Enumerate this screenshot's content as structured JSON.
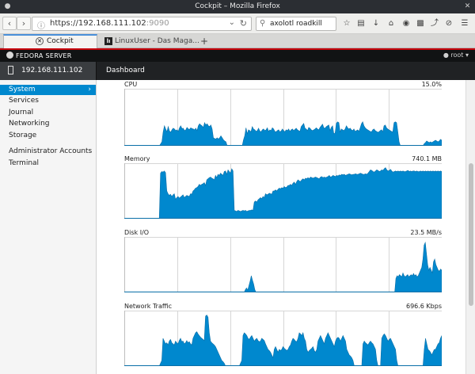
{
  "window": {
    "title": "Cockpit – Mozilla Firefox"
  },
  "nav": {
    "url_host": "https://192.168.111.102",
    "url_port": ":9090",
    "search_value": "axolotl roadkill"
  },
  "tabs": [
    {
      "label": "Cockpit"
    },
    {
      "label": "LinuxUser - Das Maga..."
    }
  ],
  "header": {
    "brand": "FEDORA SERVER",
    "user": "root"
  },
  "host": {
    "name": "192.168.111.102"
  },
  "breadcrumb": "Dashboard",
  "sidebar": {
    "items": [
      {
        "label": "System"
      },
      {
        "label": "Services"
      },
      {
        "label": "Journal"
      },
      {
        "label": "Networking"
      },
      {
        "label": "Storage"
      },
      {
        "label": "Administrator Accounts"
      },
      {
        "label": "Terminal"
      }
    ],
    "active_index": 0
  },
  "colors": {
    "accent": "#0088ce",
    "header_bg": "#111314",
    "brand_red": "#c7000b"
  },
  "charts": [
    {
      "title": "CPU",
      "value": "15.0%",
      "samples": [
        0,
        0,
        0,
        0,
        0,
        0,
        0,
        0,
        0,
        0,
        0,
        0,
        0,
        0,
        0,
        0,
        0,
        0,
        0,
        0,
        0,
        0,
        0,
        0,
        0,
        0,
        0,
        0,
        0,
        0.05,
        0.1,
        0.35,
        0.5,
        0.42,
        0.35,
        0.48,
        0.37,
        0.34,
        0.4,
        0.44,
        0.42,
        0.38,
        0.4,
        0.36,
        0.45,
        0.5,
        0.43,
        0.44,
        0.38,
        0.4,
        0.46,
        0.42,
        0.41,
        0.45,
        0.43,
        0.42,
        0.4,
        0.44,
        0.38,
        0.5,
        0.55,
        0.52,
        0.5,
        0.46,
        0.58,
        0.52,
        0.55,
        0.5,
        0.48,
        0.52,
        0.42,
        0.2,
        0.18,
        0.17,
        0.2,
        0.17,
        0.2,
        0.25,
        0.2,
        0.15,
        0.12,
        0.1,
        0,
        0,
        0,
        0,
        0,
        0,
        0,
        0,
        0,
        0,
        0,
        0,
        0,
        0.15,
        0.25,
        0.45,
        0.3,
        0.4,
        0.38,
        0.35,
        0.48,
        0.42,
        0.4,
        0.36,
        0.38,
        0.44,
        0.37,
        0.35,
        0.4,
        0.42,
        0.38,
        0.4,
        0.45,
        0.36,
        0.4,
        0.38,
        0.45,
        0.42,
        0.36,
        0.35,
        0.38,
        0.4,
        0.35,
        0.37,
        0.42,
        0.38,
        0.35,
        0.4,
        0.38,
        0.42,
        0.36,
        0.4,
        0.42,
        0.38,
        0.41,
        0.44,
        0.4,
        0.38,
        0.36,
        0.48,
        0.52,
        0.56,
        0.44,
        0.42,
        0.38,
        0.46,
        0.44,
        0.4,
        0.38,
        0.4,
        0.42,
        0.45,
        0.42,
        0.4,
        0.46,
        0.5,
        0.54,
        0.45,
        0.44,
        0.48,
        0.5,
        0.52,
        0.38,
        0.46,
        0.5,
        0.3,
        0.32,
        0.56,
        0.6,
        0.58,
        0.35,
        0.42,
        0.4,
        0.38,
        0.42,
        0.5,
        0.45,
        0.42,
        0.44,
        0.4,
        0.38,
        0.42,
        0.36,
        0.38,
        0.4,
        0.36,
        0.45,
        0.55,
        0.6,
        0.5,
        0.45,
        0.42,
        0.4,
        0.38,
        0.36,
        0.35,
        0.4,
        0.42,
        0.38,
        0.36,
        0.34,
        0.35,
        0.38,
        0.4,
        0.35,
        0.5,
        0.52,
        0.45,
        0.42,
        0.4,
        0.38,
        0.36,
        0.35,
        0.58,
        0.6,
        0.58,
        0.35,
        0.1,
        0,
        0,
        0,
        0,
        0,
        0,
        0,
        0,
        0,
        0,
        0,
        0,
        0,
        0,
        0,
        0,
        0,
        0,
        0,
        0.05,
        0.08,
        0.12,
        0.1,
        0.08,
        0.1,
        0.08,
        0.1,
        0.12,
        0.14,
        0.12,
        0.1,
        0.12,
        0.16,
        0.14
      ],
      "fill_height": 0.7
    },
    {
      "title": "Memory",
      "value": "740.1 MB",
      "samples": [
        0,
        0,
        0,
        0,
        0,
        0,
        0,
        0,
        0,
        0,
        0,
        0,
        0,
        0,
        0,
        0,
        0,
        0,
        0,
        0,
        0,
        0,
        0,
        0,
        0,
        0,
        0,
        0,
        0,
        0.82,
        0.85,
        0.84,
        0.86,
        0.83,
        0.5,
        0.45,
        0.42,
        0.44,
        0.4,
        0.43,
        0.45,
        0.35,
        0.38,
        0.4,
        0.37,
        0.39,
        0.41,
        0.43,
        0.38,
        0.4,
        0.42,
        0.41,
        0.4,
        0.45,
        0.44,
        0.5,
        0.52,
        0.55,
        0.56,
        0.58,
        0.62,
        0.6,
        0.62,
        0.63,
        0.65,
        0.6,
        0.7,
        0.72,
        0.74,
        0.75,
        0.73,
        0.72,
        0.7,
        0.78,
        0.74,
        0.8,
        0.78,
        0.82,
        0.8,
        0.78,
        0.85,
        0.86,
        0.8,
        0.88,
        0.85,
        0.82,
        0.9,
        0.86,
        0.15,
        0.14,
        0.13,
        0.15,
        0.14,
        0.13,
        0.14,
        0.15,
        0.14,
        0.15,
        0.13,
        0.14,
        0.15,
        0.15,
        0.16,
        0.15,
        0.3,
        0.32,
        0.3,
        0.34,
        0.36,
        0.38,
        0.36,
        0.4,
        0.38,
        0.45,
        0.43,
        0.44,
        0.46,
        0.45,
        0.44,
        0.5,
        0.5,
        0.52,
        0.5,
        0.53,
        0.55,
        0.54,
        0.56,
        0.55,
        0.58,
        0.56,
        0.57,
        0.6,
        0.6,
        0.62,
        0.6,
        0.64,
        0.66,
        0.62,
        0.67,
        0.7,
        0.68,
        0.67,
        0.7,
        0.72,
        0.7,
        0.73,
        0.72,
        0.74,
        0.72,
        0.75,
        0.74,
        0.73,
        0.74,
        0.75,
        0.74,
        0.73,
        0.72,
        0.75,
        0.76,
        0.74,
        0.75,
        0.74,
        0.75,
        0.76,
        0.78,
        0.75,
        0.76,
        0.78,
        0.77,
        0.76,
        0.78,
        0.77,
        0.79,
        0.78,
        0.8,
        0.79,
        0.8,
        0.78,
        0.79,
        0.8,
        0.81,
        0.8,
        0.79,
        0.8,
        0.8,
        0.81,
        0.8,
        0.8,
        0.81,
        0.82,
        0.81,
        0.8,
        0.8,
        0.81,
        0.8,
        0.82,
        0.85,
        0.88,
        0.87,
        0.85,
        0.84,
        0.86,
        0.88,
        0.87,
        0.85,
        0.86,
        0.88,
        0.87,
        0.9,
        0.92,
        0.88,
        0.86,
        0.87,
        0.89,
        0.86,
        0.84,
        0.85,
        0.86,
        0.85,
        0.86,
        0.85,
        0.86,
        0.85,
        0.86,
        0.85,
        0.85,
        0.86,
        0.87,
        0.85,
        0.86,
        0.85,
        0.86,
        0.86,
        0.85,
        0.86,
        0.85,
        0.85,
        0.86,
        0.85,
        0.86,
        0.85,
        0.86,
        0.85,
        0.86,
        0.85,
        0.86,
        0.85,
        0.86,
        0.85,
        0.86,
        0.85,
        0.86,
        0.85,
        0.86,
        0.85
      ],
      "fill_height": 1.0
    },
    {
      "title": "Disk I/O",
      "value": "23.5 MB/s",
      "samples": [
        0,
        0,
        0,
        0,
        0,
        0,
        0,
        0,
        0,
        0,
        0,
        0,
        0,
        0,
        0,
        0,
        0,
        0,
        0,
        0,
        0,
        0,
        0,
        0,
        0,
        0,
        0,
        0,
        0,
        0,
        0,
        0,
        0,
        0,
        0,
        0,
        0,
        0,
        0,
        0,
        0,
        0,
        0,
        0,
        0,
        0,
        0,
        0,
        0,
        0,
        0,
        0,
        0,
        0,
        0,
        0,
        0,
        0,
        0,
        0,
        0,
        0,
        0,
        0,
        0,
        0,
        0,
        0,
        0,
        0,
        0,
        0,
        0,
        0,
        0,
        0,
        0,
        0,
        0,
        0,
        0,
        0,
        0,
        0,
        0,
        0,
        0,
        0,
        0,
        0,
        0,
        0,
        0,
        0,
        0,
        0,
        0,
        0,
        0,
        0,
        0,
        0,
        0,
        0.05,
        0.08,
        0.04,
        0.12,
        0.2,
        0.3,
        0.22,
        0.15,
        0.05,
        0,
        0,
        0,
        0,
        0,
        0,
        0,
        0,
        0,
        0,
        0,
        0,
        0,
        0,
        0,
        0,
        0,
        0,
        0,
        0,
        0,
        0,
        0,
        0,
        0,
        0,
        0,
        0,
        0,
        0,
        0,
        0,
        0,
        0,
        0,
        0,
        0,
        0,
        0,
        0,
        0,
        0,
        0,
        0,
        0,
        0,
        0,
        0,
        0,
        0,
        0,
        0,
        0,
        0,
        0,
        0,
        0,
        0,
        0,
        0,
        0,
        0,
        0,
        0,
        0,
        0,
        0,
        0,
        0,
        0,
        0,
        0,
        0,
        0,
        0,
        0,
        0,
        0,
        0,
        0,
        0,
        0,
        0,
        0,
        0,
        0,
        0,
        0,
        0,
        0,
        0,
        0,
        0,
        0,
        0,
        0,
        0,
        0,
        0,
        0,
        0,
        0,
        0,
        0,
        0,
        0,
        0,
        0,
        0,
        0,
        0,
        0,
        0,
        0,
        0,
        0,
        0,
        0,
        0,
        0.25,
        0.3,
        0.28,
        0.32,
        0.3,
        0.28,
        0.35,
        0.3,
        0.28,
        0.3,
        0.32,
        0.28,
        0.3,
        0.32,
        0.3,
        0.34,
        0.3,
        0.32,
        0.28,
        0.3,
        0.35,
        0.4,
        0.45,
        0.6,
        0.85,
        0.9,
        0.7,
        0.5,
        0.4,
        0.45,
        0.4,
        0.35,
        0.55,
        0.6,
        0.5,
        0.45,
        0.4,
        0.38,
        0.42,
        0.4
      ],
      "fill_height": 1.0
    },
    {
      "title": "Network Traffic",
      "value": "696.6 Kbps",
      "samples": [
        0,
        0,
        0,
        0,
        0,
        0,
        0,
        0,
        0,
        0,
        0,
        0,
        0,
        0,
        0,
        0,
        0,
        0,
        0,
        0,
        0,
        0,
        0,
        0,
        0,
        0,
        0,
        0,
        0,
        0.05,
        0.1,
        0.5,
        0.45,
        0.4,
        0.42,
        0.38,
        0.45,
        0.48,
        0.42,
        0.4,
        0.38,
        0.45,
        0.42,
        0.4,
        0.46,
        0.5,
        0.44,
        0.45,
        0.4,
        0.42,
        0.46,
        0.42,
        0.44,
        0.4,
        0.38,
        0.5,
        0.55,
        0.6,
        0.62,
        0.58,
        0.55,
        0.52,
        0.5,
        0.48,
        0.46,
        0.9,
        0.92,
        0.88,
        0.6,
        0.45,
        0.42,
        0.4,
        0.38,
        0.35,
        0.3,
        0.25,
        0.2,
        0.15,
        0.1,
        0.08,
        0.05,
        0,
        0,
        0,
        0,
        0,
        0,
        0,
        0,
        0,
        0,
        0,
        0,
        0.05,
        0.1,
        0.55,
        0.6,
        0.58,
        0.55,
        0.5,
        0.48,
        0.52,
        0.55,
        0.5,
        0.45,
        0.48,
        0.5,
        0.46,
        0.44,
        0.45,
        0.5,
        0.48,
        0.46,
        0.4,
        0.35,
        0.3,
        0.28,
        0.25,
        0.2,
        0.15,
        0.3,
        0.35,
        0.3,
        0.25,
        0.3,
        0.28,
        0.3,
        0.35,
        0.32,
        0.3,
        0.28,
        0.3,
        0.35,
        0.38,
        0.45,
        0.5,
        0.48,
        0.45,
        0.44,
        0.5,
        0.6,
        0.58,
        0.55,
        0.6,
        0.5,
        0.45,
        0.3,
        0.25,
        0.28,
        0.3,
        0.32,
        0.35,
        0.28,
        0.25,
        0.3,
        0.45,
        0.5,
        0.55,
        0.5,
        0.45,
        0.4,
        0.5,
        0.55,
        0.6,
        0.55,
        0.5,
        0.45,
        0.4,
        0.35,
        0.45,
        0.5,
        0.52,
        0.5,
        0.45,
        0.5,
        0.55,
        0.5,
        0.45,
        0.3,
        0.25,
        0.2,
        0.18,
        0.15,
        0.1,
        0,
        0,
        0,
        0,
        0,
        0,
        0,
        0.4,
        0.45,
        0.42,
        0.4,
        0.38,
        0.42,
        0.45,
        0.42,
        0.4,
        0.35,
        0.3,
        0.1,
        0,
        0,
        0,
        0.5,
        0.55,
        0.58,
        0.55,
        0.5,
        0.45,
        0.48,
        0.5,
        0.45,
        0.4,
        0.35,
        0.3,
        0.1,
        0,
        0,
        0,
        0,
        0,
        0,
        0,
        0,
        0,
        0,
        0,
        0,
        0,
        0,
        0,
        0,
        0,
        0,
        0,
        0,
        0,
        0.3,
        0.5,
        0.4,
        0.3,
        0.28,
        0.25,
        0.2,
        0.25,
        0.3,
        0.3,
        0.35,
        0.4,
        0.42,
        0.5,
        0.55
      ],
      "fill_height": 1.0
    }
  ]
}
